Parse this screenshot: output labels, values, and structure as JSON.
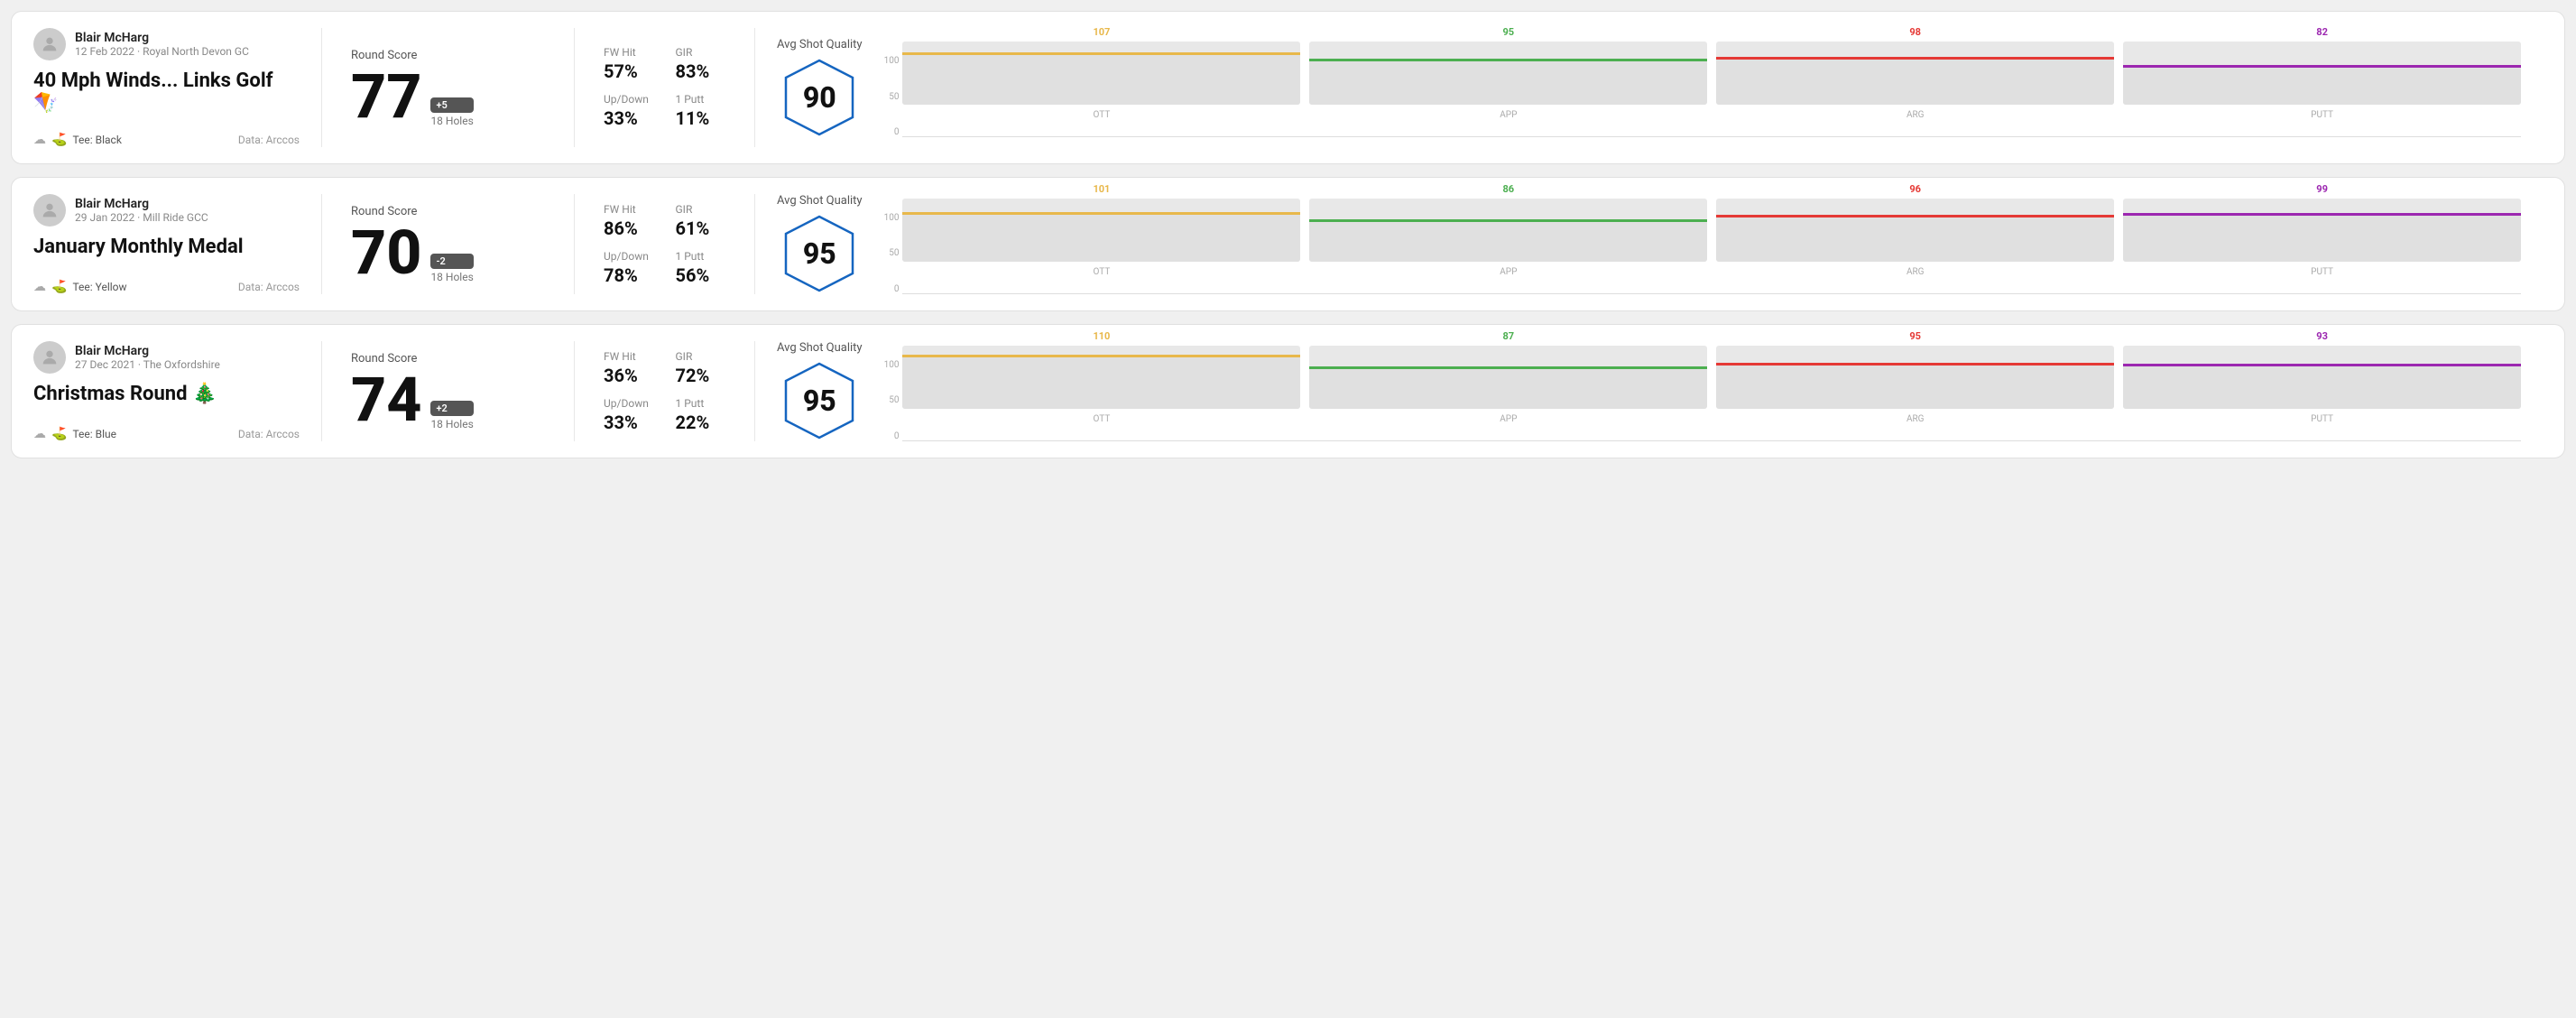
{
  "rounds": [
    {
      "id": "round1",
      "user": {
        "name": "Blair McHarg",
        "date": "12 Feb 2022 · Royal North Devon GC",
        "avatar": "person"
      },
      "title": "40 Mph Winds... Links Golf 🪁",
      "tee": "Black",
      "data_source": "Data: Arccos",
      "score": "77",
      "score_diff": "+5",
      "holes": "18 Holes",
      "fw_hit": "57%",
      "gir": "83%",
      "up_down": "33%",
      "one_putt": "11%",
      "avg_shot_quality": "90",
      "bars": [
        {
          "label": "OTT",
          "value": 107,
          "color": "#e8b84b"
        },
        {
          "label": "APP",
          "value": 95,
          "color": "#4caf50"
        },
        {
          "label": "ARG",
          "value": 98,
          "color": "#e53935"
        },
        {
          "label": "PUTT",
          "value": 82,
          "color": "#9c27b0"
        }
      ]
    },
    {
      "id": "round2",
      "user": {
        "name": "Blair McHarg",
        "date": "29 Jan 2022 · Mill Ride GCC",
        "avatar": "person"
      },
      "title": "January Monthly Medal",
      "tee": "Yellow",
      "data_source": "Data: Arccos",
      "score": "70",
      "score_diff": "-2",
      "holes": "18 Holes",
      "fw_hit": "86%",
      "gir": "61%",
      "up_down": "78%",
      "one_putt": "56%",
      "avg_shot_quality": "95",
      "bars": [
        {
          "label": "OTT",
          "value": 101,
          "color": "#e8b84b"
        },
        {
          "label": "APP",
          "value": 86,
          "color": "#4caf50"
        },
        {
          "label": "ARG",
          "value": 96,
          "color": "#e53935"
        },
        {
          "label": "PUTT",
          "value": 99,
          "color": "#9c27b0"
        }
      ]
    },
    {
      "id": "round3",
      "user": {
        "name": "Blair McHarg",
        "date": "27 Dec 2021 · The Oxfordshire",
        "avatar": "person"
      },
      "title": "Christmas Round 🎄",
      "tee": "Blue",
      "data_source": "Data: Arccos",
      "score": "74",
      "score_diff": "+2",
      "holes": "18 Holes",
      "fw_hit": "36%",
      "gir": "72%",
      "up_down": "33%",
      "one_putt": "22%",
      "avg_shot_quality": "95",
      "bars": [
        {
          "label": "OTT",
          "value": 110,
          "color": "#e8b84b"
        },
        {
          "label": "APP",
          "value": 87,
          "color": "#4caf50"
        },
        {
          "label": "ARG",
          "value": 95,
          "color": "#e53935"
        },
        {
          "label": "PUTT",
          "value": 93,
          "color": "#9c27b0"
        }
      ]
    }
  ],
  "labels": {
    "round_score": "Round Score",
    "fw_hit": "FW Hit",
    "gir": "GIR",
    "up_down": "Up/Down",
    "one_putt": "1 Putt",
    "avg_shot_quality": "Avg Shot Quality",
    "tee_prefix": "Tee:",
    "y_axis": [
      "100",
      "50",
      "0"
    ]
  }
}
